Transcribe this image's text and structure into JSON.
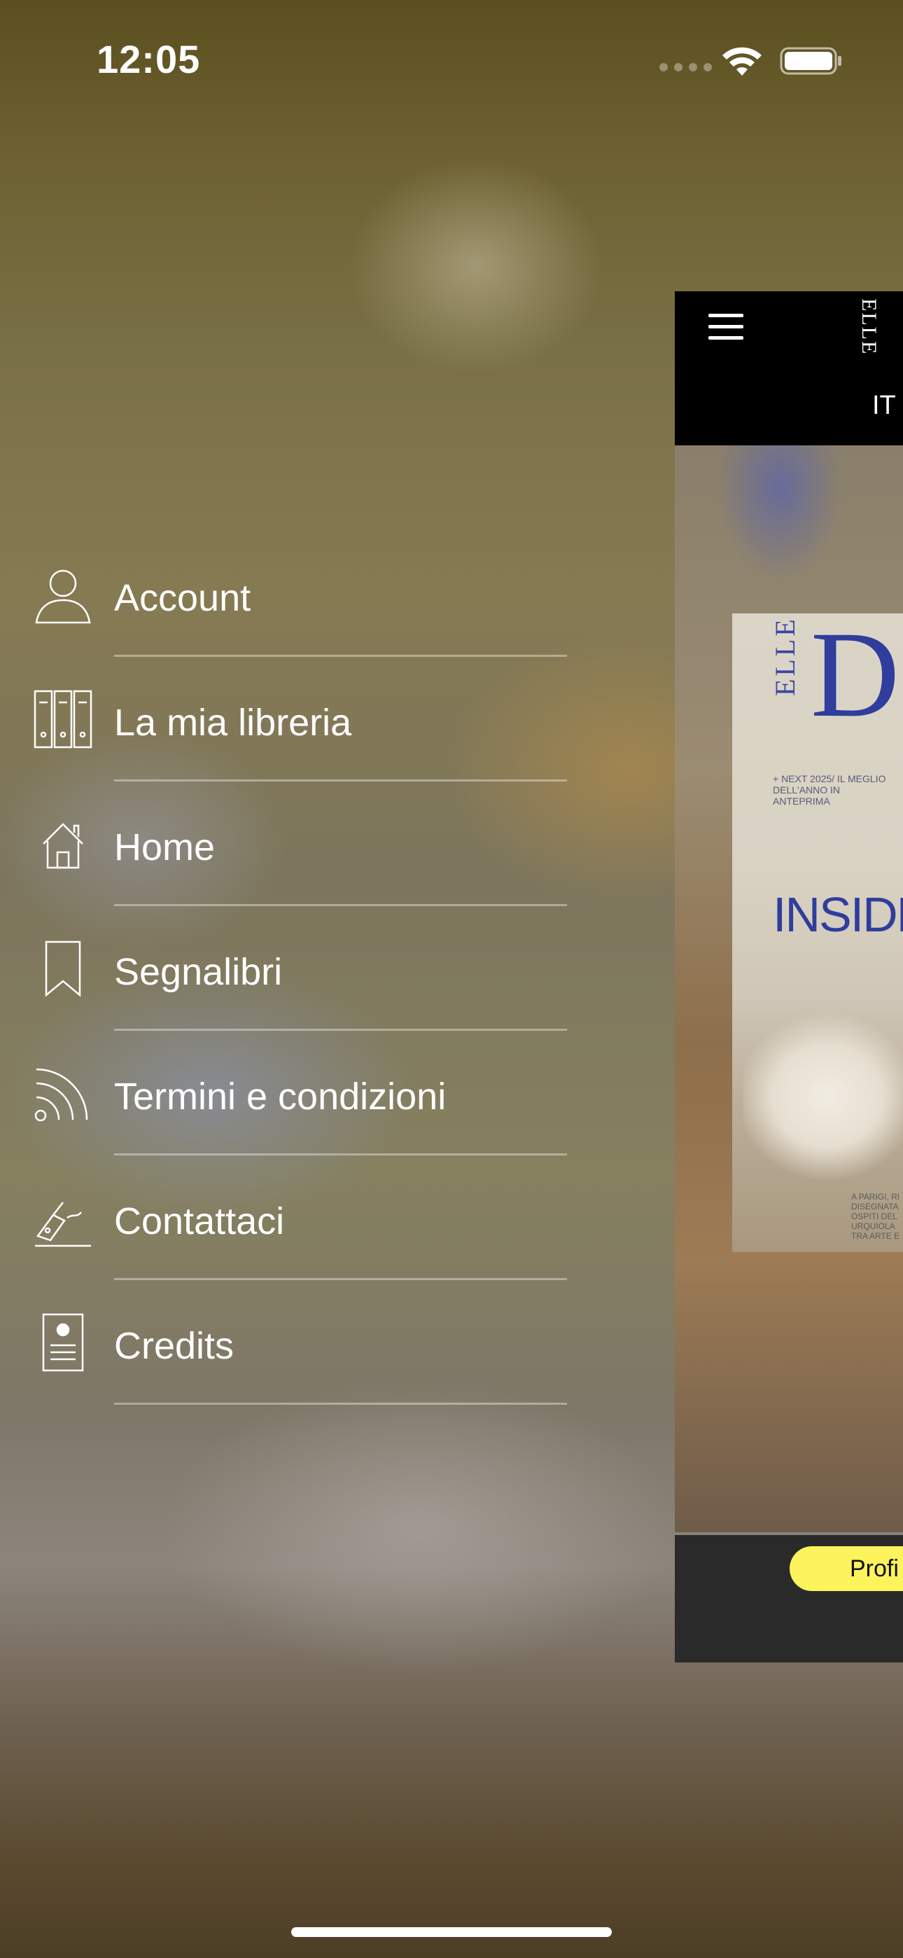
{
  "status_bar": {
    "time": "12:05"
  },
  "menu": {
    "items": [
      {
        "label": "Account",
        "icon": "person-icon"
      },
      {
        "label": "La mia libreria",
        "icon": "library-binders-icon"
      },
      {
        "label": "Home",
        "icon": "house-icon"
      },
      {
        "label": "Segnalibri",
        "icon": "bookmark-icon"
      },
      {
        "label": "Termini e condizioni",
        "icon": "rss-icon"
      },
      {
        "label": "Contattaci",
        "icon": "pen-signature-icon"
      },
      {
        "label": "Credits",
        "icon": "id-card-icon"
      }
    ]
  },
  "preview": {
    "logo": "ELLE",
    "language": "IT",
    "cover": {
      "masthead": "ELLE",
      "masthead_letter": "D",
      "kicker": "+ NEXT 2025/ IL MEGLIO DELL'ANNO IN ANTEPRIMA",
      "headline": "INSIDE",
      "caption": "A PARIGI, RI DISEGNATA OSPITI DEL URQUIOLA TRA ARTE E"
    },
    "profile_button": "Profi"
  },
  "colors": {
    "accent_button": "#fdf35c",
    "header_bg": "#000000",
    "footer_bg": "#2a2a2a",
    "divider": "rgba(255,255,255,0.38)"
  }
}
